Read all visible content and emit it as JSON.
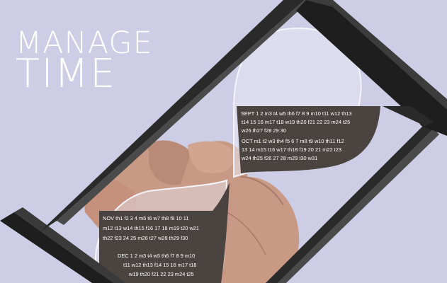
{
  "headline": {
    "line1": "MANAGE",
    "line2": "TIME"
  },
  "colors": {
    "background": "#cdcde6",
    "frame": "#2a2a2a",
    "hand": "#c89a86",
    "sand": "#4a4340",
    "glass": "#e6e6f2"
  },
  "calendar_upper": {
    "rows": [
      "SEPT 1 2 m3 t4 w5 th6 f7 8 9 m10 t11 w12 th13",
      "t14 15 16 m17 t18 w19 th20 f21 22 23 m24 t25",
      "w26 th27 f28 29 30",
      "OCT m1 t2 w3 th4 f5 6 7 m8 t9 w10 th11 f12",
      "13 14 m15 t16 w17 th18 f19 20 21 m22 t23",
      "w24 th25 f26 27 28 m29 t30 w31"
    ]
  },
  "calendar_lower": {
    "rows": [
      "NOV th1 f2 3 4 m5 t6 w7 th8 f9 10 11",
      "m12 t13 w14 th15 f16 17 18 m19 t20 w21",
      "th22 f23 24 25 m26 t27 w28 th29 f30",
      "DEC 1 2 m3 t4 w5 th6 f7 8 9 m10",
      "t11 w12 th13 f14 15 16 m17 t18",
      "w19 th20 f21 22 23 m24 t25"
    ]
  }
}
